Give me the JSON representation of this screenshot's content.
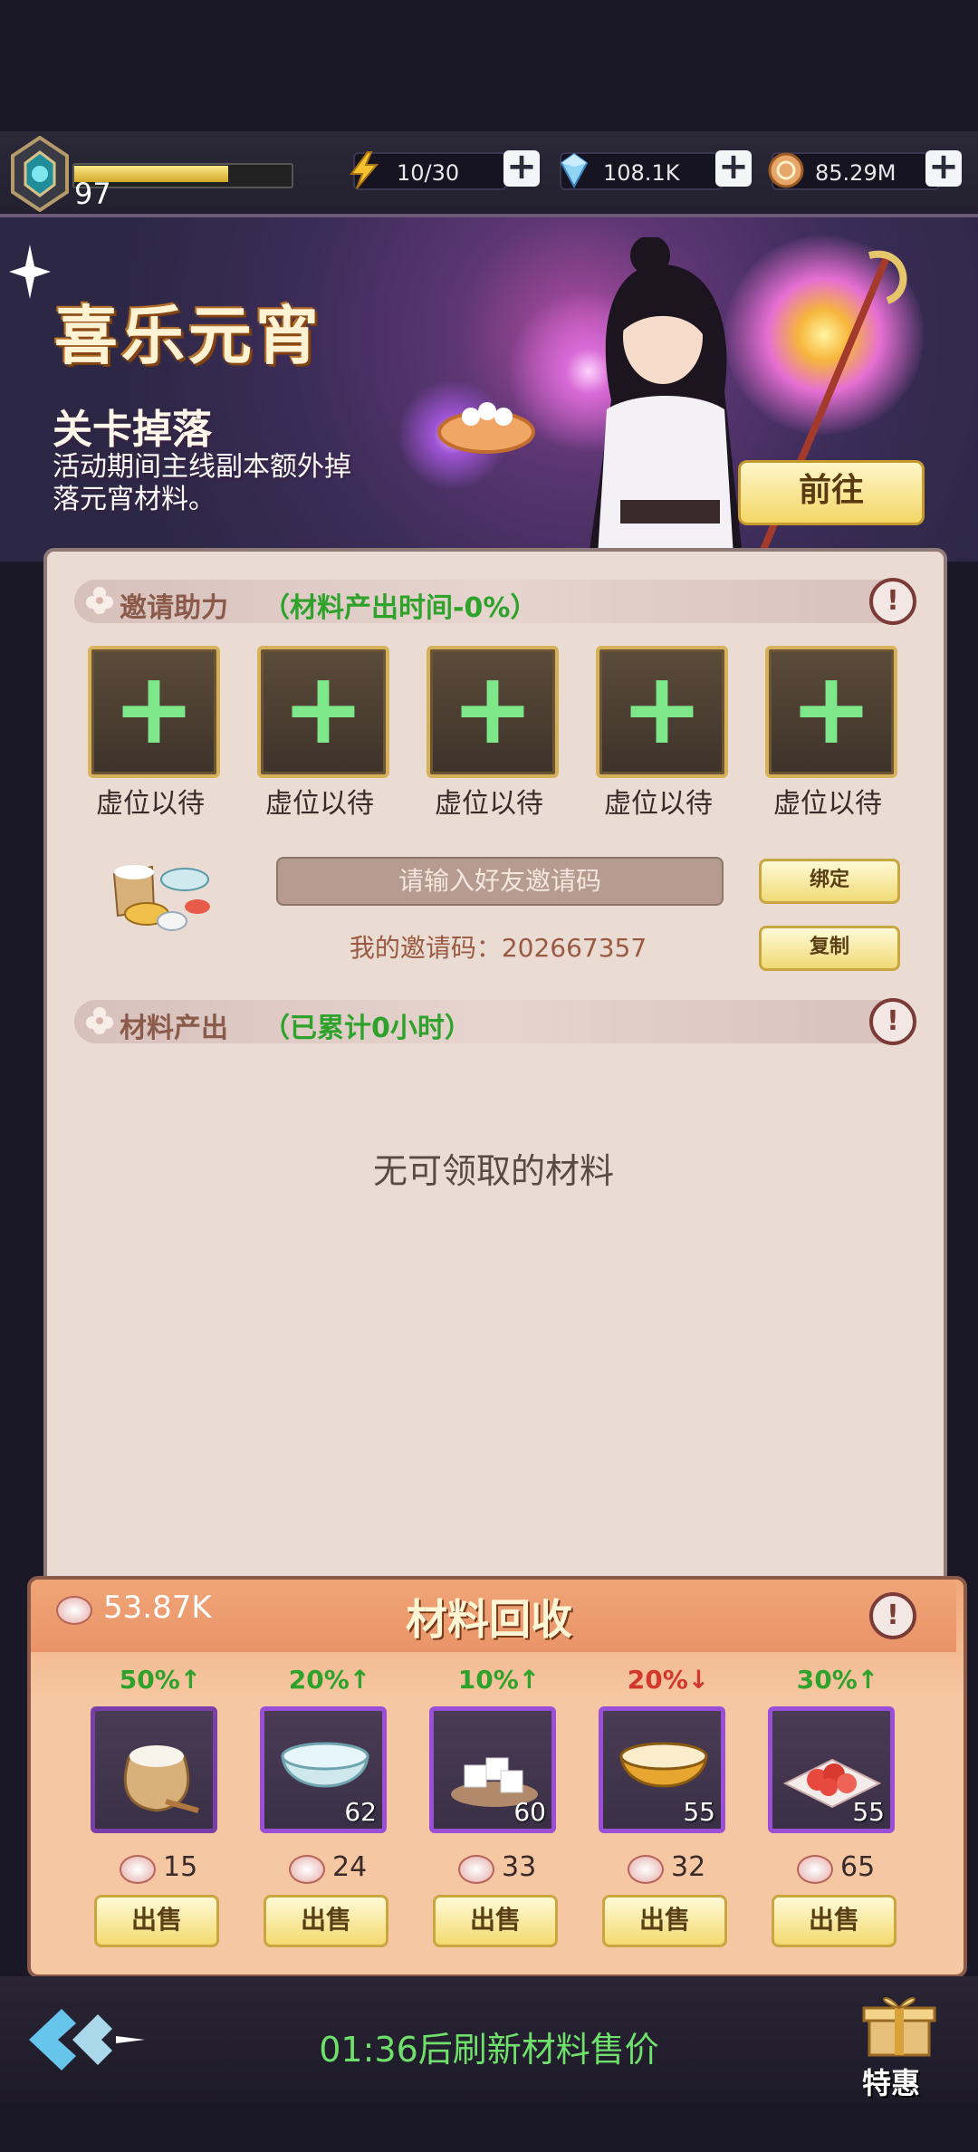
{
  "status": {
    "level": "97",
    "energy": "10/30",
    "gems": "108.1K",
    "coins": "85.29M"
  },
  "banner": {
    "title": "喜乐元宵",
    "subtitle": "关卡掉落",
    "description": "活动期间主线副本额外掉落元宵材料。",
    "go_button": "前往"
  },
  "invite": {
    "section_label": "邀请助力",
    "section_note": "（材料产出时间-0%）",
    "slots": [
      {
        "label": "虚位以待"
      },
      {
        "label": "虚位以待"
      },
      {
        "label": "虚位以待"
      },
      {
        "label": "虚位以待"
      },
      {
        "label": "虚位以待"
      }
    ],
    "code_placeholder": "请输入好友邀请码",
    "my_code": "我的邀请码：202667357",
    "bind_button": "绑定",
    "copy_button": "复制"
  },
  "output": {
    "section_label": "材料产出",
    "section_note": "（已累计0小时）",
    "empty_message": "无可领取的材料"
  },
  "recycle": {
    "title": "材料回收",
    "total": "53.87K",
    "items": [
      {
        "name": "flour-sack",
        "trend": "50%↑",
        "direction": "up",
        "count": "",
        "price": "15",
        "sell": "出售"
      },
      {
        "name": "water-bowl",
        "trend": "20%↑",
        "direction": "up",
        "count": "62",
        "price": "24",
        "sell": "出售"
      },
      {
        "name": "sugar-cubes",
        "trend": "10%↑",
        "direction": "up",
        "count": "60",
        "price": "33",
        "sell": "出售"
      },
      {
        "name": "milk-bowl",
        "trend": "20%↓",
        "direction": "down",
        "count": "55",
        "price": "32",
        "sell": "出售"
      },
      {
        "name": "rose-petals",
        "trend": "30%↑",
        "direction": "up",
        "count": "55",
        "price": "65",
        "sell": "出售"
      }
    ]
  },
  "footer": {
    "refresh_text": "01:36后刷新材料售价",
    "special_label": "特惠"
  },
  "colors": {
    "accent_green": "#2ea22b",
    "accent_red": "#d2382b",
    "panel_bg": "#eadbd3"
  }
}
